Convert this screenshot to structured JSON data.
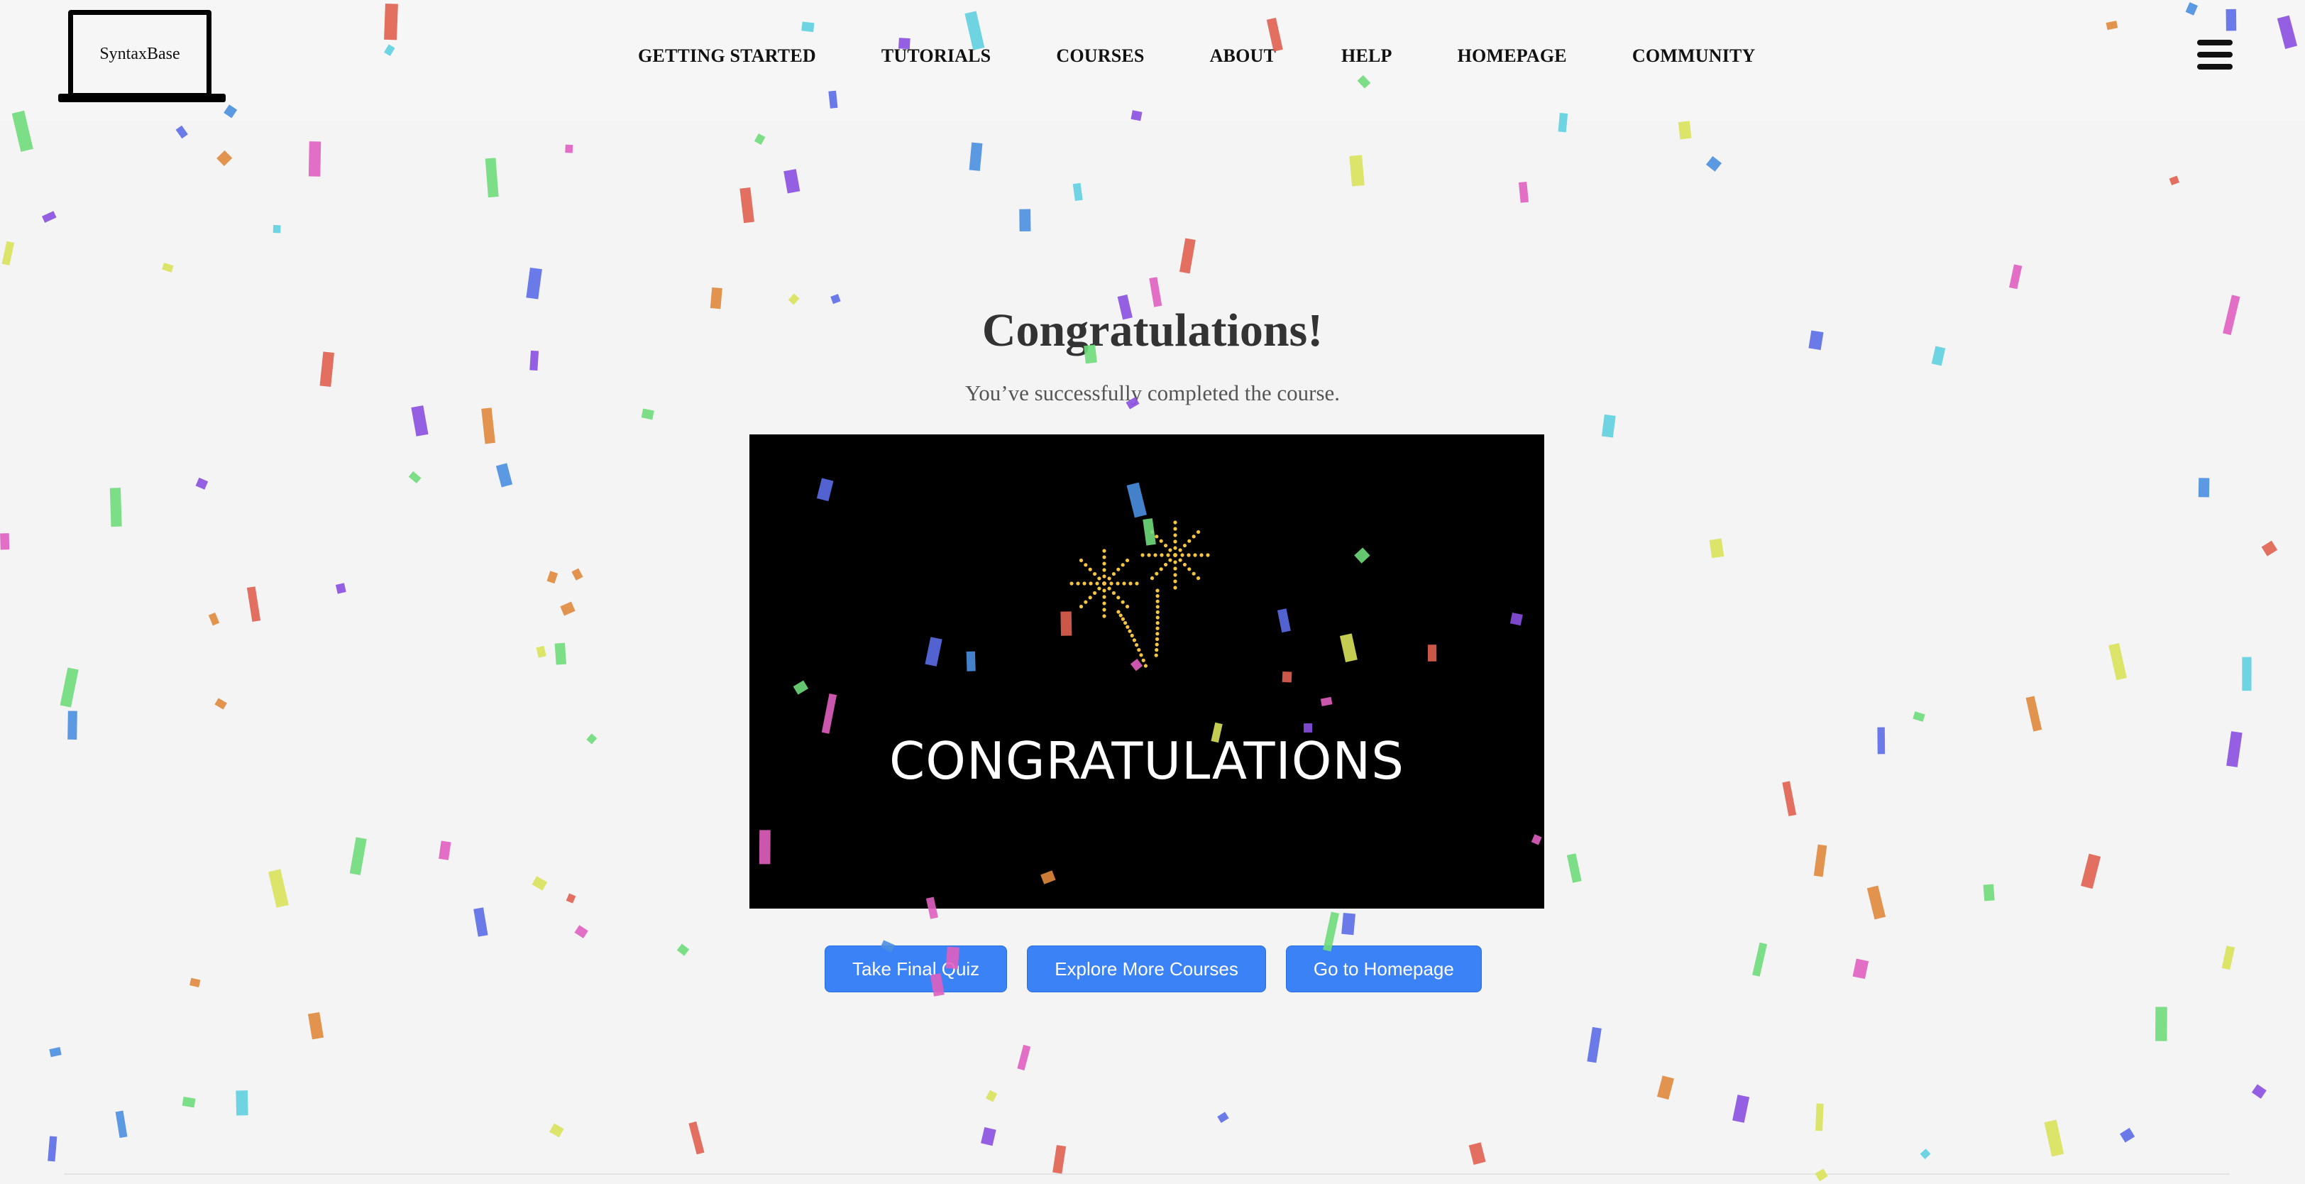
{
  "header": {
    "logo_text": "SyntaxBase",
    "nav": [
      "GETTING STARTED",
      "TUTORIALS",
      "COURSES",
      "ABOUT",
      "HELP",
      "HOMEPAGE",
      "COMMUNITY"
    ],
    "menu_icon": "hamburger-menu-icon"
  },
  "main": {
    "title": "Congratulations!",
    "subtitle": "You’ve successfully completed the course.",
    "video": {
      "caption": "CONGRATULATIONS",
      "firework_color": "#f5c542"
    },
    "buttons": [
      "Take Final Quiz",
      "Explore More Courses",
      "Go to Homepage"
    ]
  },
  "colors": {
    "background": "#f4f4f4",
    "button": "#3b82f6",
    "confetti": [
      "#8a4fe0",
      "#5b6ee8",
      "#6fdc7a",
      "#d9e35a",
      "#e05fc0",
      "#e08a3c",
      "#e0604f",
      "#5fd0e0",
      "#4a8fe0"
    ]
  }
}
